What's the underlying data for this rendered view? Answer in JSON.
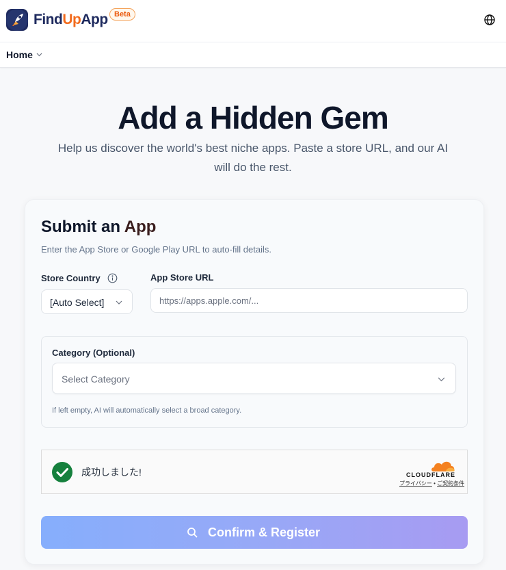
{
  "header": {
    "brand_part1": "Find",
    "brand_part2": "Up",
    "brand_part3": "App",
    "badge": "Beta",
    "brand_color": "#1e2a5e",
    "accent_color": "#f26b1d",
    "language_icon": "globe-icon"
  },
  "nav": {
    "home_label": "Home",
    "home_icon": "chevron-down-icon"
  },
  "hero": {
    "title": "Add a Hidden Gem",
    "subtitle": "Help us discover the world's best niche apps. Paste a store URL, and our AI will do the rest."
  },
  "form": {
    "title_part1": "Submit an ",
    "title_part2": "App",
    "description": "Enter the App Store or Google Play URL to auto-fill details.",
    "country_label": "Store Country",
    "country_value": "[Auto Select]",
    "url_label": "App Store URL",
    "url_placeholder": "https://apps.apple.com/...",
    "category_label": "Category (Optional)",
    "category_placeholder": "Select Category",
    "category_hint": "If left empty, AI will automatically select a broad category.",
    "submit_label": "Confirm & Register",
    "submit_icon": "search-icon"
  },
  "captcha": {
    "status": "成功しました!",
    "provider": "CLOUDFLARE",
    "privacy_link": "プライバシー",
    "separator": " • ",
    "terms_link": "ご契約条件",
    "success_color": "#15803d",
    "provider_color": "#f48120"
  }
}
